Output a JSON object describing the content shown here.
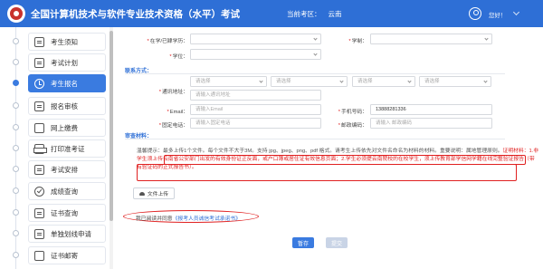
{
  "header": {
    "title": "全国计算机技术与软件专业技术资格（水平）考试",
    "region_label": "当前考区：",
    "region_value": "云南",
    "username": "您好！"
  },
  "sidebar": {
    "items": [
      {
        "label": "考生须知",
        "active": false
      },
      {
        "label": "考试计划",
        "active": false
      },
      {
        "label": "考生报名",
        "active": true
      },
      {
        "label": "报名审核",
        "active": false
      },
      {
        "label": "网上缴费",
        "active": false
      },
      {
        "label": "打印准考证",
        "active": false
      },
      {
        "label": "考试安排",
        "active": false
      },
      {
        "label": "成绩查询",
        "active": false
      },
      {
        "label": "证书查询",
        "active": false
      },
      {
        "label": "单独划线申请",
        "active": false
      },
      {
        "label": "证书邮寄",
        "active": false
      }
    ]
  },
  "form": {
    "school_label": "在学/已肄学历：",
    "degree_label": "学制：",
    "degree2_label": "学位：",
    "contact_section": "联系方式：",
    "address_label": "通讯地址：",
    "select_placeholder": "请选择",
    "address_placeholder": "请输入通讯地址",
    "email_label": "Email：",
    "email_placeholder": "请输入Email",
    "phone_label": "手机号码：",
    "phone_value": "13888281336",
    "landline_label": "固定电话：",
    "landline_placeholder": "请输入固定电话",
    "postcode_label": "邮政编码：",
    "postcode_placeholder": "请输入 邮政编码",
    "materials_section": "审查材料：",
    "notice_text_1": "温馨提示：最多上传1个文件。每个文件不大于3M。支持 jpg、jpeg、png、pdf 格式。请考生上传依先对文件名命名为材料的材料。重要说明：属地管理原则。",
    "notice_red_1": "证明材料：1.非学生须上传云南省公安部门出发的有效身份证正反面，或户口簿或居住证有效信息页面；2.学生必须提云南院校的在校学生，",
    "notice_red_2": "须上传教育部学信网学籍在线完整验证报告（带有验证码的正式报告书）。",
    "upload_button": "文件上传",
    "agree_text": "我已阅读并同意",
    "agree_link": "《报考人员诚信考试承诺书》",
    "save_button": "暂存",
    "submit_button": "提交"
  },
  "colors": {
    "header_bg": "#2e6fd6",
    "accent": "#3a7be0",
    "highlight_red": "#e02020"
  }
}
